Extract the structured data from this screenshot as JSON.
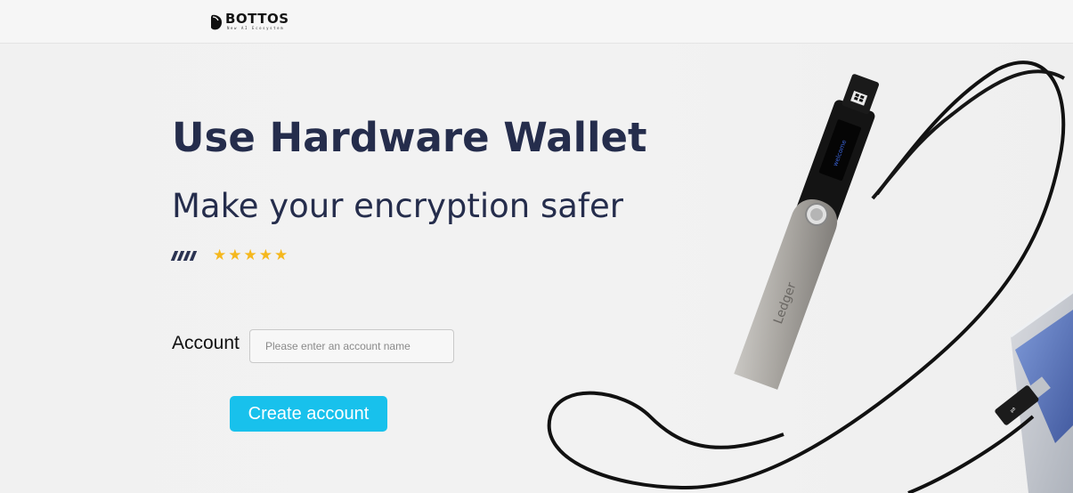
{
  "header": {
    "brand_name": "BOTTOS",
    "brand_tagline": "New AI Ecosystem"
  },
  "hero": {
    "title": "Use Hardware Wallet",
    "subtitle": "Make your encryption safer",
    "stars": [
      "★",
      "★",
      "★",
      "★",
      "★"
    ]
  },
  "form": {
    "account_label": "Account",
    "account_placeholder": "Please enter an account name",
    "account_value": "",
    "create_button_label": "Create account"
  },
  "device": {
    "brand_text": "Ledger",
    "screen_text": "welcome"
  },
  "colors": {
    "heading": "#252d4c",
    "accent_button": "#18c1ec",
    "stars": "#f5b81e"
  }
}
